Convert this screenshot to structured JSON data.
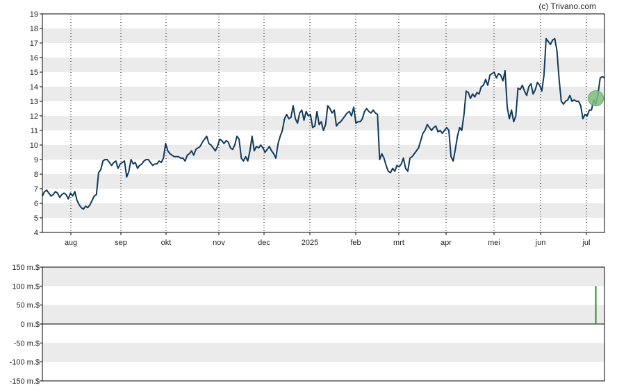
{
  "credit": "(c) Trivano.com",
  "colors": {
    "price_line": "#0f3a5c",
    "marker_fill": "#7fbf7f",
    "volume_bar": "#2e8b2e",
    "band": "#ebebeb",
    "frame": "#000000"
  },
  "chart_data": [
    {
      "type": "line",
      "ylim": [
        4,
        19
      ],
      "y_ticks": [
        "4",
        "5",
        "6",
        "7",
        "8",
        "9",
        "10",
        "11",
        "12",
        "13",
        "14",
        "15",
        "16",
        "17",
        "18",
        "19"
      ],
      "x_ticks": [
        "aug",
        "sep",
        "okt",
        "nov",
        "dec",
        "2025",
        "feb",
        "mrt",
        "apr",
        "mei",
        "jun",
        "jul"
      ],
      "grid": "vertical dotted at month boundaries, alternating horizontal bands",
      "series": [
        {
          "values": [
            6.5,
            6.8,
            6.9,
            6.7,
            6.5,
            6.6,
            6.8,
            6.7,
            6.4,
            6.6,
            6.7,
            6.6,
            6.3,
            6.7,
            6.5,
            6.8,
            6.2,
            5.9,
            5.7,
            5.6,
            5.8,
            5.7,
            5.9,
            6.2,
            6.5,
            6.6,
            8.1,
            8.3,
            8.9,
            9.0,
            9.0,
            8.8,
            8.6,
            8.8,
            8.9,
            8.4,
            8.7,
            8.8,
            8.9,
            7.8,
            8.2,
            9.0,
            8.7,
            8.8,
            8.4,
            8.6,
            8.7,
            8.9,
            9.0,
            9.0,
            8.8,
            8.6,
            8.7,
            8.7,
            8.9,
            8.8,
            9.1,
            10.1,
            9.6,
            9.4,
            9.3,
            9.2,
            9.2,
            9.2,
            9.1,
            9.1,
            8.9,
            9.3,
            9.4,
            9.6,
            9.3,
            9.7,
            9.8,
            9.9,
            10.2,
            10.4,
            10.6,
            10.1,
            10.0,
            9.8,
            9.6,
            9.9,
            10.4,
            10.3,
            10.1,
            10.3,
            10.2,
            9.8,
            9.7,
            10.0,
            10.6,
            10.4,
            9.1,
            8.9,
            9.2,
            8.9,
            9.6,
            10.6,
            9.6,
            9.9,
            9.8,
            10.0,
            9.8,
            9.5,
            9.7,
            9.9,
            9.6,
            9.4,
            9.1,
            10.1,
            10.6,
            11.0,
            11.8,
            12.1,
            11.8,
            11.9,
            12.7,
            11.8,
            11.5,
            12.2,
            12.4,
            11.7,
            12.3,
            12.0,
            12.1,
            11.2,
            11.3,
            12.3,
            11.4,
            11.6,
            11.0,
            11.4,
            12.7,
            12.5,
            12.2,
            12.4,
            11.3,
            11.5,
            11.6,
            11.8,
            12.0,
            12.2,
            12.3,
            12.0,
            12.6,
            11.5,
            11.6,
            11.6,
            11.8,
            12.3,
            12.5,
            12.3,
            12.2,
            12.4,
            12.2,
            12.1,
            9.0,
            9.4,
            9.1,
            8.6,
            8.2,
            8.1,
            8.4,
            8.2,
            8.6,
            8.5,
            8.7,
            9.1,
            8.4,
            8.2,
            9.1,
            9.2,
            9.4,
            9.6,
            9.8,
            10.3,
            10.8,
            11.0,
            11.4,
            11.2,
            11.0,
            11.2,
            11.3,
            10.9,
            11.0,
            10.8,
            11.0,
            11.2,
            11.0,
            9.2,
            8.9,
            9.7,
            10.6,
            11.2,
            11.0,
            12.1,
            13.7,
            13.6,
            13.2,
            13.5,
            13.3,
            13.6,
            13.5,
            14.0,
            14.1,
            14.5,
            14.1,
            14.8,
            14.9,
            15.0,
            14.6,
            14.9,
            14.8,
            14.4,
            15.1,
            12.6,
            11.8,
            12.4,
            11.6,
            12.0,
            13.9,
            13.8,
            14.1,
            13.7,
            13.4,
            14.0,
            14.2,
            13.5,
            13.8,
            14.3,
            14.1,
            13.7,
            14.8,
            17.3,
            17.1,
            16.9,
            17.2,
            17.3,
            16.5,
            14.5,
            13.0,
            12.8,
            13.0,
            13.1,
            13.4,
            13.0,
            13.1,
            13.0,
            13.0,
            12.7,
            11.8,
            12.1,
            12.0,
            12.4,
            12.4,
            13.1,
            12.8,
            13.5,
            14.6,
            14.7,
            14.6
          ]
        }
      ],
      "marker": {
        "index": 256,
        "value": 13.2
      }
    },
    {
      "type": "bar",
      "ylim": [
        -150,
        150
      ],
      "y_ticks": [
        "150 m.$",
        "100 m.$",
        "50 m.$",
        "0 m.$",
        "-50 m.$",
        "-100 m.$",
        "-150 m.$"
      ],
      "bars": [
        {
          "index": 256,
          "value": 100
        }
      ]
    }
  ]
}
